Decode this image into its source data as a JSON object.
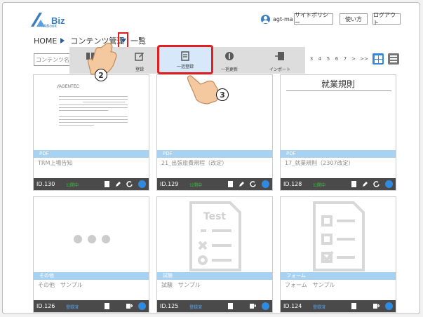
{
  "header": {
    "logo_sub": "ABook",
    "logo_main": "Biz",
    "user_name": "agt-ma",
    "buttons": [
      "サイトポリシー",
      "使い方",
      "ログアウト"
    ]
  },
  "breadcrumb": {
    "home": "HOME",
    "current": "コンテンツ管理",
    "suffix": "一覧"
  },
  "search": {
    "placeholder": "コンテンツ名"
  },
  "pager": [
    "3",
    "4",
    "5",
    "6",
    "7",
    ">",
    ">>"
  ],
  "menu": {
    "items": [
      {
        "label": "登録"
      },
      {
        "label": "一括登録"
      },
      {
        "label": "一括更新"
      },
      {
        "label": "インポート"
      }
    ]
  },
  "callouts": {
    "step2": "2",
    "step3": "3"
  },
  "cards": [
    {
      "type": "PDF",
      "title": "TRM上場告知",
      "id": "ID.130",
      "status": "公開中",
      "thumb": "doc"
    },
    {
      "type": "PDF",
      "title": "21_出張旅費規程（改定）",
      "id": "ID.129",
      "status": "公開中",
      "thumb": "blank"
    },
    {
      "type": "PDF",
      "title": "17_就業規則（2307改定）",
      "id": "ID.128",
      "status": "公開中",
      "thumb": "shugyo",
      "thumb_text": "就業規則"
    },
    {
      "type": "その他",
      "title": "その他　サンプル",
      "id": "ID.126",
      "status": "登録済",
      "thumb": "dots"
    },
    {
      "type": "試験",
      "title": "試験　サンプル",
      "id": "ID.125",
      "status": "登録済",
      "thumb": "test",
      "thumb_text": "Test"
    },
    {
      "type": "フォーム",
      "title": "フォーム　サンプル",
      "id": "ID.124",
      "status": "登録済",
      "thumb": "form"
    }
  ],
  "colors": {
    "accent": "#2e8be0",
    "highlight": "#e02020",
    "type_bar": "#a8d2f2",
    "footer": "#4a4a4a"
  }
}
